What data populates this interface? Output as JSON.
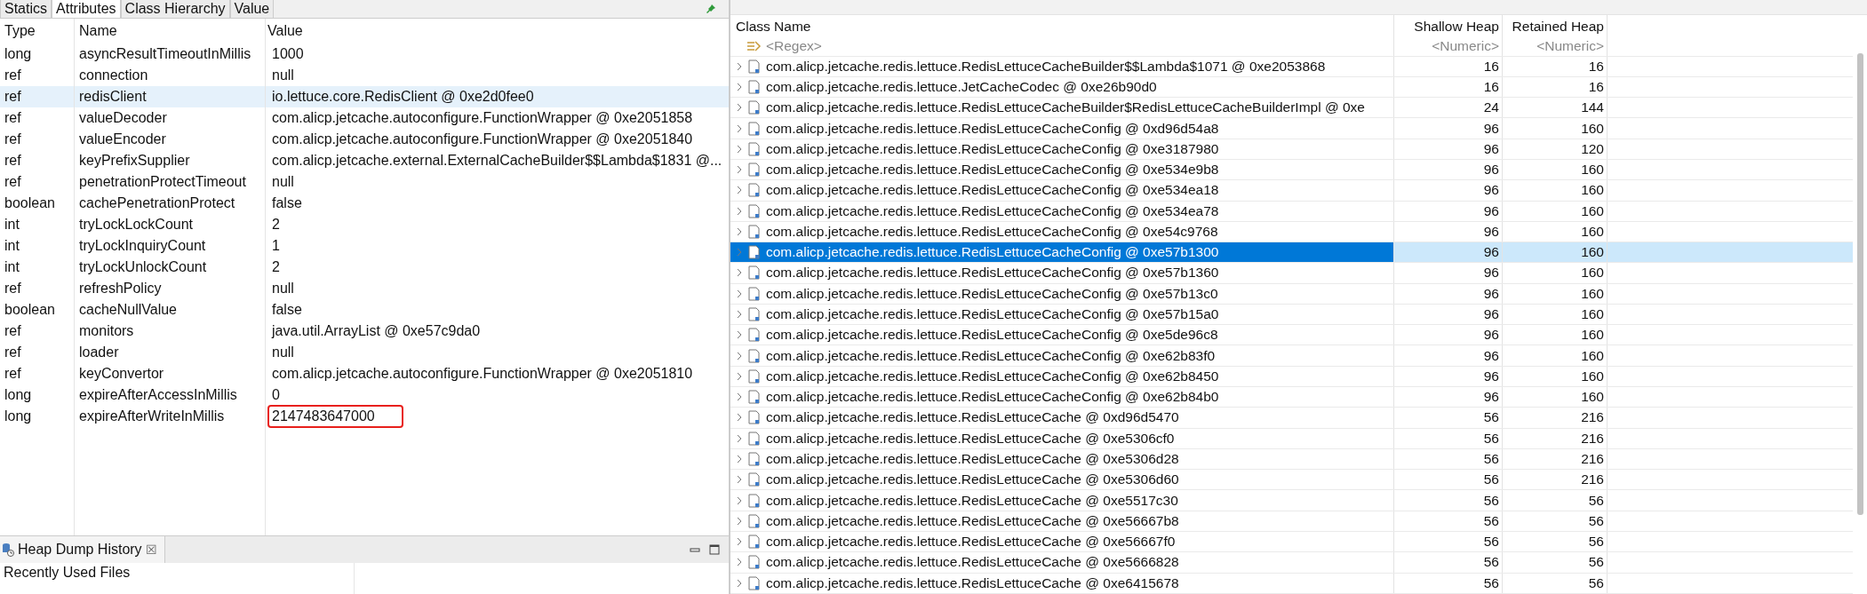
{
  "inspector": {
    "tabs": [
      {
        "label": "Statics",
        "selected": false
      },
      {
        "label": "Attributes",
        "selected": true
      },
      {
        "label": "Class Hierarchy",
        "selected": false
      },
      {
        "label": "Value",
        "selected": false
      }
    ],
    "columns": [
      "Type",
      "Name",
      "Value"
    ],
    "rows": [
      {
        "type": "long",
        "name": "asyncResultTimeoutInMillis",
        "value": "1000",
        "selected": false,
        "highlighted": false
      },
      {
        "type": "ref",
        "name": "connection",
        "value": "null",
        "selected": false,
        "highlighted": false
      },
      {
        "type": "ref",
        "name": "redisClient",
        "value": "io.lettuce.core.RedisClient @ 0xe2d0fee0",
        "selected": true,
        "highlighted": false
      },
      {
        "type": "ref",
        "name": "valueDecoder",
        "value": "com.alicp.jetcache.autoconfigure.FunctionWrapper @ 0xe2051858",
        "selected": false,
        "highlighted": false
      },
      {
        "type": "ref",
        "name": "valueEncoder",
        "value": "com.alicp.jetcache.autoconfigure.FunctionWrapper @ 0xe2051840",
        "selected": false,
        "highlighted": false
      },
      {
        "type": "ref",
        "name": "keyPrefixSupplier",
        "value": "com.alicp.jetcache.external.ExternalCacheBuilder$$Lambda$1831 @...",
        "selected": false,
        "highlighted": false
      },
      {
        "type": "ref",
        "name": "penetrationProtectTimeout",
        "value": "null",
        "selected": false,
        "highlighted": false
      },
      {
        "type": "boolean",
        "name": "cachePenetrationProtect",
        "value": "false",
        "selected": false,
        "highlighted": false
      },
      {
        "type": "int",
        "name": "tryLockLockCount",
        "value": "2",
        "selected": false,
        "highlighted": false
      },
      {
        "type": "int",
        "name": "tryLockInquiryCount",
        "value": "1",
        "selected": false,
        "highlighted": false
      },
      {
        "type": "int",
        "name": "tryLockUnlockCount",
        "value": "2",
        "selected": false,
        "highlighted": false
      },
      {
        "type": "ref",
        "name": "refreshPolicy",
        "value": "null",
        "selected": false,
        "highlighted": false
      },
      {
        "type": "boolean",
        "name": "cacheNullValue",
        "value": "false",
        "selected": false,
        "highlighted": false
      },
      {
        "type": "ref",
        "name": "monitors",
        "value": "java.util.ArrayList @ 0xe57c9da0",
        "selected": false,
        "highlighted": false
      },
      {
        "type": "ref",
        "name": "loader",
        "value": "null",
        "selected": false,
        "highlighted": false
      },
      {
        "type": "ref",
        "name": "keyConvertor",
        "value": "com.alicp.jetcache.autoconfigure.FunctionWrapper @ 0xe2051810",
        "selected": false,
        "highlighted": false
      },
      {
        "type": "long",
        "name": "expireAfterAccessInMillis",
        "value": "0",
        "selected": false,
        "highlighted": false
      },
      {
        "type": "long",
        "name": "expireAfterWriteInMillis",
        "value": "2147483647000",
        "selected": false,
        "highlighted": true
      }
    ]
  },
  "history": {
    "title": "Heap Dump History",
    "close": "☒",
    "section": "Recently Used Files"
  },
  "objects": {
    "columns": [
      "Class Name",
      "Shallow Heap",
      "Retained Heap"
    ],
    "filters": [
      "<Regex>",
      "<Numeric>",
      "<Numeric>"
    ],
    "rows": [
      {
        "name": "com.alicp.jetcache.redis.lettuce.RedisLettuceCacheBuilder$$Lambda$1071 @ 0xe2053868",
        "shallow": "16",
        "retained": "16",
        "selected": false
      },
      {
        "name": "com.alicp.jetcache.redis.lettuce.JetCacheCodec @ 0xe26b90d0",
        "shallow": "16",
        "retained": "16",
        "selected": false
      },
      {
        "name": "com.alicp.jetcache.redis.lettuce.RedisLettuceCacheBuilder$RedisLettuceCacheBuilderImpl @ 0xe",
        "shallow": "24",
        "retained": "144",
        "selected": false
      },
      {
        "name": "com.alicp.jetcache.redis.lettuce.RedisLettuceCacheConfig @ 0xd96d54a8",
        "shallow": "96",
        "retained": "160",
        "selected": false
      },
      {
        "name": "com.alicp.jetcache.redis.lettuce.RedisLettuceCacheConfig @ 0xe3187980",
        "shallow": "96",
        "retained": "120",
        "selected": false
      },
      {
        "name": "com.alicp.jetcache.redis.lettuce.RedisLettuceCacheConfig @ 0xe534e9b8",
        "shallow": "96",
        "retained": "160",
        "selected": false
      },
      {
        "name": "com.alicp.jetcache.redis.lettuce.RedisLettuceCacheConfig @ 0xe534ea18",
        "shallow": "96",
        "retained": "160",
        "selected": false
      },
      {
        "name": "com.alicp.jetcache.redis.lettuce.RedisLettuceCacheConfig @ 0xe534ea78",
        "shallow": "96",
        "retained": "160",
        "selected": false
      },
      {
        "name": "com.alicp.jetcache.redis.lettuce.RedisLettuceCacheConfig @ 0xe54c9768",
        "shallow": "96",
        "retained": "160",
        "selected": false
      },
      {
        "name": "com.alicp.jetcache.redis.lettuce.RedisLettuceCacheConfig @ 0xe57b1300",
        "shallow": "96",
        "retained": "160",
        "selected": true
      },
      {
        "name": "com.alicp.jetcache.redis.lettuce.RedisLettuceCacheConfig @ 0xe57b1360",
        "shallow": "96",
        "retained": "160",
        "selected": false
      },
      {
        "name": "com.alicp.jetcache.redis.lettuce.RedisLettuceCacheConfig @ 0xe57b13c0",
        "shallow": "96",
        "retained": "160",
        "selected": false
      },
      {
        "name": "com.alicp.jetcache.redis.lettuce.RedisLettuceCacheConfig @ 0xe57b15a0",
        "shallow": "96",
        "retained": "160",
        "selected": false
      },
      {
        "name": "com.alicp.jetcache.redis.lettuce.RedisLettuceCacheConfig @ 0xe5de96c8",
        "shallow": "96",
        "retained": "160",
        "selected": false
      },
      {
        "name": "com.alicp.jetcache.redis.lettuce.RedisLettuceCacheConfig @ 0xe62b83f0",
        "shallow": "96",
        "retained": "160",
        "selected": false
      },
      {
        "name": "com.alicp.jetcache.redis.lettuce.RedisLettuceCacheConfig @ 0xe62b8450",
        "shallow": "96",
        "retained": "160",
        "selected": false
      },
      {
        "name": "com.alicp.jetcache.redis.lettuce.RedisLettuceCacheConfig @ 0xe62b84b0",
        "shallow": "96",
        "retained": "160",
        "selected": false
      },
      {
        "name": "com.alicp.jetcache.redis.lettuce.RedisLettuceCache @ 0xd96d5470",
        "shallow": "56",
        "retained": "216",
        "selected": false
      },
      {
        "name": "com.alicp.jetcache.redis.lettuce.RedisLettuceCache @ 0xe5306cf0",
        "shallow": "56",
        "retained": "216",
        "selected": false
      },
      {
        "name": "com.alicp.jetcache.redis.lettuce.RedisLettuceCache @ 0xe5306d28",
        "shallow": "56",
        "retained": "216",
        "selected": false
      },
      {
        "name": "com.alicp.jetcache.redis.lettuce.RedisLettuceCache @ 0xe5306d60",
        "shallow": "56",
        "retained": "216",
        "selected": false
      },
      {
        "name": "com.alicp.jetcache.redis.lettuce.RedisLettuceCache @ 0xe5517c30",
        "shallow": "56",
        "retained": "56",
        "selected": false
      },
      {
        "name": "com.alicp.jetcache.redis.lettuce.RedisLettuceCache @ 0xe56667b8",
        "shallow": "56",
        "retained": "56",
        "selected": false
      },
      {
        "name": "com.alicp.jetcache.redis.lettuce.RedisLettuceCache @ 0xe56667f0",
        "shallow": "56",
        "retained": "56",
        "selected": false
      },
      {
        "name": "com.alicp.jetcache.redis.lettuce.RedisLettuceCache @ 0xe5666828",
        "shallow": "56",
        "retained": "56",
        "selected": false
      },
      {
        "name": "com.alicp.jetcache.redis.lettuce.RedisLettuceCache @ 0xe6415678",
        "shallow": "56",
        "retained": "56",
        "selected": false
      }
    ]
  }
}
